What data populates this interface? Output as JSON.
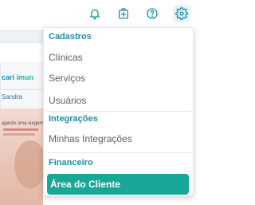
{
  "topbar": {
    "icons": [
      "bell-icon",
      "medical-kit-icon",
      "help-icon",
      "gear-icon"
    ],
    "icon_color": "#1d8fa9"
  },
  "background": {
    "brand_a": "cari",
    "brand_b": "imun",
    "name": "Sandra",
    "promo_text": "ajando uma viagem?"
  },
  "menu": {
    "sections": [
      {
        "title": "Cadastros",
        "items": [
          "Clínicas",
          "Serviços",
          "Usuários"
        ]
      },
      {
        "title": "Integrações",
        "items": [
          "Minhas Integrações"
        ]
      },
      {
        "title": "Financeiro",
        "items": [
          "Área do Cliente"
        ]
      }
    ]
  },
  "colors": {
    "section_title": "#1d8fa9",
    "item_text": "#5b5f66",
    "cta_background": "#17a898",
    "cta_text": "#ffffff"
  }
}
